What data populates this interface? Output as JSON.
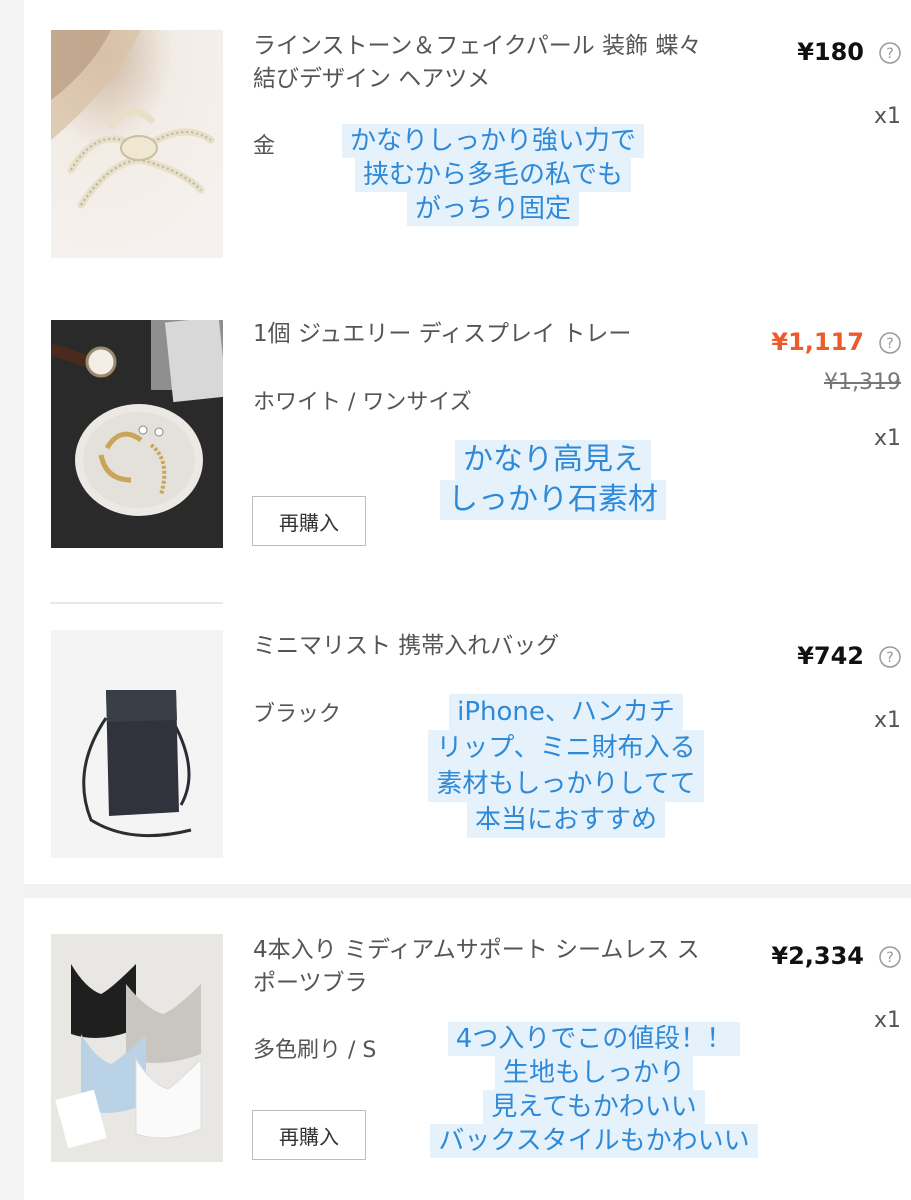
{
  "items": [
    {
      "title": "ラインストーン＆フェイクパール 装飾 蝶々結びデザイン ヘアツメ",
      "variant": "金",
      "price": "¥180",
      "original_price": "",
      "quantity": "x1",
      "rebuy_label": "",
      "note_lines": [
        "かなりしっかり強い力で",
        "挟むから多毛の私でも",
        "がっちり固定"
      ]
    },
    {
      "title": "1個 ジュエリー ディスプレイ トレー",
      "variant": "ホワイト / ワンサイズ",
      "price": "¥1,117",
      "original_price": "¥1,319",
      "quantity": "x1",
      "rebuy_label": "再購入",
      "note_lines": [
        "かなり高見え",
        "しっかり石素材"
      ]
    },
    {
      "title": "ミニマリスト 携帯入れバッグ",
      "variant": "ブラック",
      "price": "¥742",
      "original_price": "",
      "quantity": "x1",
      "rebuy_label": "",
      "note_lines": [
        "iPhone、ハンカチ",
        "リップ、ミニ財布入る",
        "素材もしっかりしてて",
        "本当におすすめ"
      ]
    },
    {
      "title": "4本入り ミディアムサポート シームレス スポーツブラ",
      "variant": "多色刷り / S",
      "price": "¥2,334",
      "original_price": "",
      "quantity": "x1",
      "rebuy_label": "再購入",
      "note_lines": [
        "4つ入りでこの値段！！",
        "生地もしっかり",
        "見えてもかわいい",
        "バックスタイルもかわいい"
      ]
    }
  ],
  "colors": {
    "sale_price": "#ee5a2c",
    "note_text": "#2e8ad8",
    "note_bg": "#e6f2fb"
  },
  "icons": {
    "help": "question-circle-icon"
  }
}
